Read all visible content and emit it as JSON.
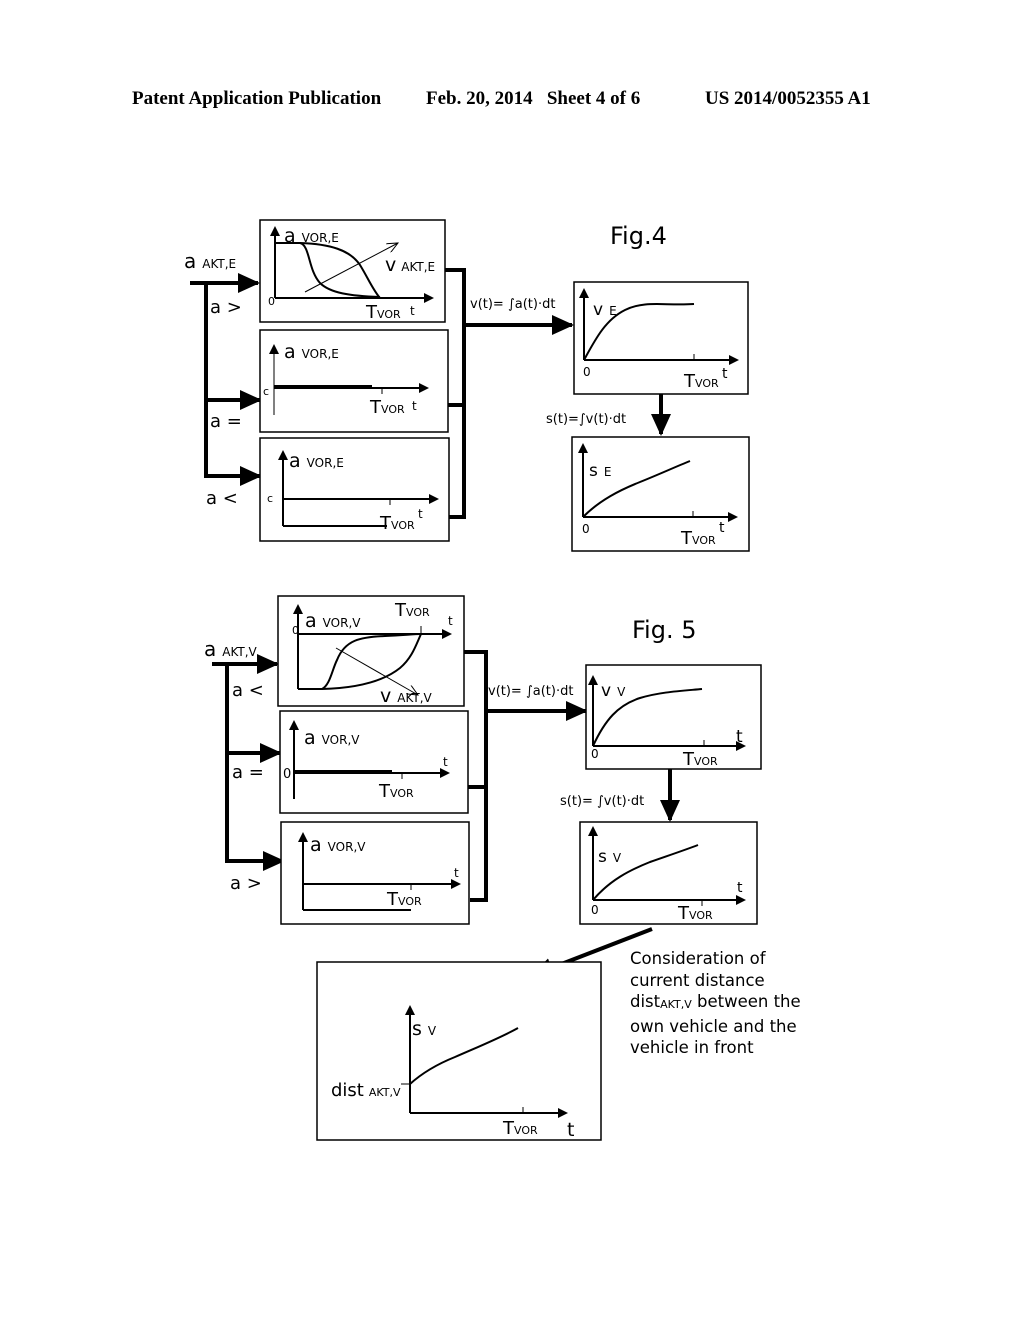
{
  "header": {
    "left": "Patent Application Publication",
    "date_sheet": "Feb. 20, 2014   Sheet 4 of 6",
    "number": "US 2014/0052355 A1"
  },
  "fig4": {
    "title": "Fig.4",
    "input_label": "a",
    "input_sub": "AKT,E",
    "branches": [
      "a >",
      "a =",
      "a <"
    ],
    "panel_y_label": "a",
    "panel_y_sub": "VOR,E",
    "panel_v_label": "v",
    "panel_v_sub": "AKT,E",
    "c_label": "c",
    "zero": "0",
    "t": "t",
    "tvor": "T",
    "tvor_sub": "VOR",
    "integral_v": "v(t)= ∫a(t)·dt",
    "integral_s": "s(t)=∫v(t)·dt",
    "vel_label": "v",
    "vel_sub": "E",
    "dist_label": "s",
    "dist_sub": "E"
  },
  "fig5": {
    "title": "Fig. 5",
    "input_label": "a",
    "input_sub": "AKT,V",
    "branches": [
      "a <",
      "a =",
      "a >"
    ],
    "panel_y_label": "a",
    "panel_y_sub": "VOR,V",
    "panel_v_label": "v",
    "panel_v_sub": "AKT,V",
    "zero": "0",
    "t": "t",
    "tvor": "T",
    "tvor_sub": "VOR",
    "integral_v": "v(t)= ∫a(t)·dt",
    "integral_s": "s(t)= ∫v(t)·dt",
    "vel_label": "v",
    "vel_sub": "V",
    "dist_label": "s",
    "dist_sub": "V",
    "final_y_label": "s",
    "final_y_sub": "V",
    "final_offset_label": "dist",
    "final_offset_sub": "AKT,V"
  },
  "note": {
    "line1": "Consideration of",
    "line2": "current distance",
    "line3_pre": "dist",
    "line3_sub": "AKT,V",
    "line3_post": " between the",
    "line4": "own vehicle and the",
    "line5": "vehicle in front"
  }
}
